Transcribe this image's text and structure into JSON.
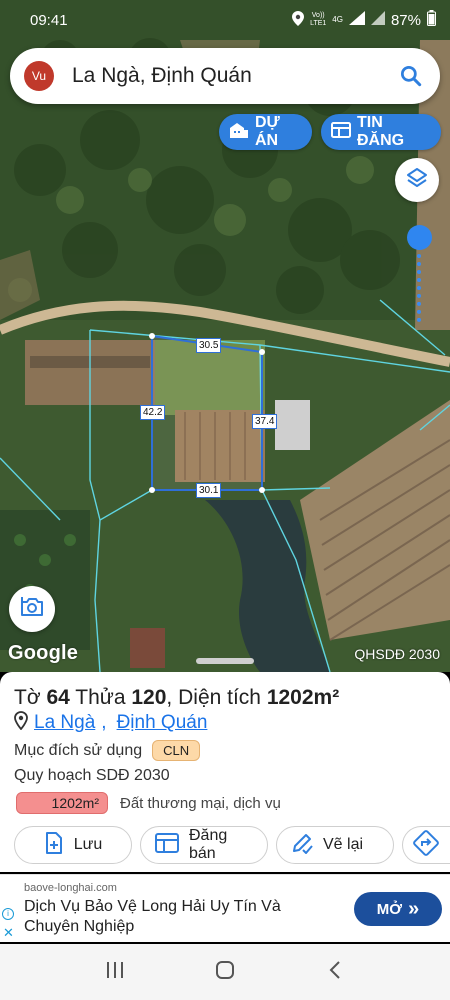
{
  "status": {
    "time": "09:41",
    "network_top": "Vo))",
    "network_bottom": "LTE1",
    "signal_label": "4G",
    "battery": "87%"
  },
  "search": {
    "avatar": "Vu",
    "query": "La Ngà, Định Quán",
    "icon": "search-icon"
  },
  "map_buttons": {
    "projects": "DỰ ÁN",
    "listings": "TIN ĐĂNG",
    "layers_icon": "layers-icon",
    "camera_icon": "camera-icon"
  },
  "map": {
    "google_logo": "Google",
    "layer_label": "QHSDĐ 2030",
    "dimensions": {
      "top": "30.5",
      "left": "42.2",
      "right": "37.4",
      "bottom": "30.1"
    }
  },
  "parcel": {
    "sheet_prefix": "Tờ",
    "sheet": "64",
    "plot_prefix": "Thửa",
    "plot": "120",
    "area_prefix": "Diện tích",
    "area": "1202m²",
    "location": {
      "commune": "La Ngà",
      "district": "Định Quán"
    },
    "purpose_label": "Mục đích sử dụng",
    "purpose_code": "CLN",
    "plan_label": "Quy hoạch SDĐ 2030",
    "plan_area": "1202m²",
    "plan_desc": "Đất thương mại, dịch vụ"
  },
  "actions": {
    "save": "Lưu",
    "sell": "Đăng bán",
    "redraw": "Vẽ lại"
  },
  "ad": {
    "domain": "baove-longhai.com",
    "text": "Dịch Vụ Bảo Vệ Long Hải Uy Tín Và Chuyên Nghiệp",
    "cta": "MỞ",
    "cta_arrow": "»"
  },
  "colors": {
    "accent": "#2f7fde",
    "badge_cln": "#fdd9a8",
    "badge_area": "#f48f8f",
    "ad_button": "#1c4f9c"
  }
}
